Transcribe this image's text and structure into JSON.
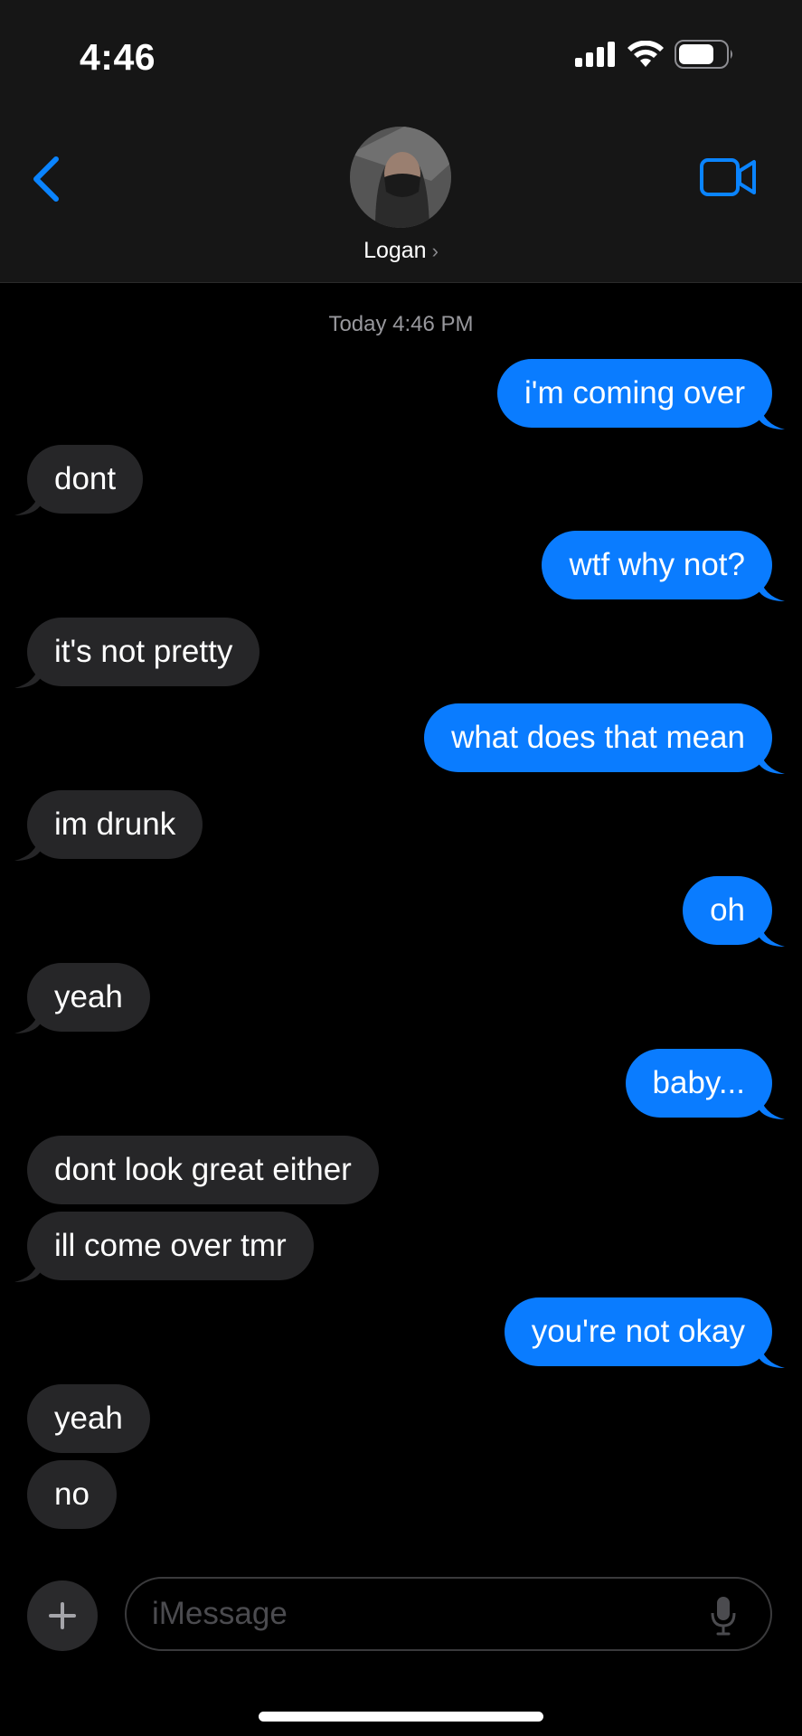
{
  "status_bar": {
    "time": "4:46"
  },
  "header": {
    "contact_name": "Logan",
    "chevron": "›"
  },
  "conversation": {
    "timestamp": "Today 4:46 PM",
    "messages": [
      {
        "from": "me",
        "text": "i'm coming over"
      },
      {
        "from": "them",
        "text": "dont"
      },
      {
        "from": "me",
        "text": "wtf why not?"
      },
      {
        "from": "them",
        "text": "it's not pretty"
      },
      {
        "from": "me",
        "text": "what does that mean"
      },
      {
        "from": "them",
        "text": "im drunk"
      },
      {
        "from": "me",
        "text": "oh"
      },
      {
        "from": "them",
        "text": "yeah"
      },
      {
        "from": "me",
        "text": "baby..."
      },
      {
        "from": "them",
        "text": "dont look great either"
      },
      {
        "from": "them",
        "text": "ill come over tmr"
      },
      {
        "from": "me",
        "text": "you're not okay"
      },
      {
        "from": "them",
        "text": "yeah"
      },
      {
        "from": "them",
        "text": "no"
      }
    ]
  },
  "composer": {
    "placeholder": "iMessage"
  },
  "icons": [
    "cellular-signal-icon",
    "wifi-icon",
    "battery-icon",
    "back-chevron-icon",
    "video-call-icon",
    "plus-icon",
    "microphone-icon"
  ],
  "colors": {
    "sent_bubble": "#0a7cff",
    "received_bubble": "#262628",
    "accent": "#0a84ff"
  }
}
